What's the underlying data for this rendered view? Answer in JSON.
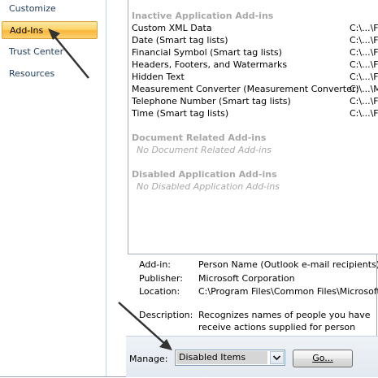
{
  "nav": {
    "items": [
      {
        "label": "Customize",
        "selected": false
      },
      {
        "label": "Add-Ins",
        "selected": true
      },
      {
        "label": "Trust Center",
        "selected": false
      },
      {
        "label": "Resources",
        "selected": false
      }
    ]
  },
  "addins": {
    "inactive_header": "Inactive Application Add-ins",
    "inactive_items": [
      {
        "name": "Custom XML Data",
        "location": "C:\\...\\Fi"
      },
      {
        "name": "Date (Smart tag lists)",
        "location": "C:\\...\\Fi"
      },
      {
        "name": "Financial Symbol (Smart tag lists)",
        "location": "C:\\...\\Fi"
      },
      {
        "name": "Headers, Footers, and Watermarks",
        "location": "C:\\...\\Fi"
      },
      {
        "name": "Hidden Text",
        "location": "C:\\...\\Fi"
      },
      {
        "name": "Measurement Converter (Measurement Converter)",
        "location": "C:\\...\\M"
      },
      {
        "name": "Telephone Number (Smart tag lists)",
        "location": "C:\\...\\Fi"
      },
      {
        "name": "Time (Smart tag lists)",
        "location": "C:\\...\\Fi"
      }
    ],
    "document_header": "Document Related Add-ins",
    "document_empty": "No Document Related Add-ins",
    "disabled_header": "Disabled Application Add-ins",
    "disabled_empty": "No Disabled Application Add-ins"
  },
  "details": {
    "addin_label": "Add-in:",
    "addin_value": "Person Name (Outlook e-mail recipients)",
    "publisher_label": "Publisher:",
    "publisher_value": "Microsoft Corporation",
    "location_label": "Location:",
    "location_value": "C:\\Program Files\\Common Files\\Microsoft Sh",
    "description_label": "Description:",
    "description_value": "Recognizes names of people you have receive actions supplied for person names."
  },
  "manage": {
    "label": "Manage:",
    "selected": "Disabled Items",
    "go_label": "Go..."
  },
  "colors": {
    "selected_tab": "#fcd46c",
    "section_header": "#a8a8a8",
    "annotation_arrow": "#333333"
  }
}
